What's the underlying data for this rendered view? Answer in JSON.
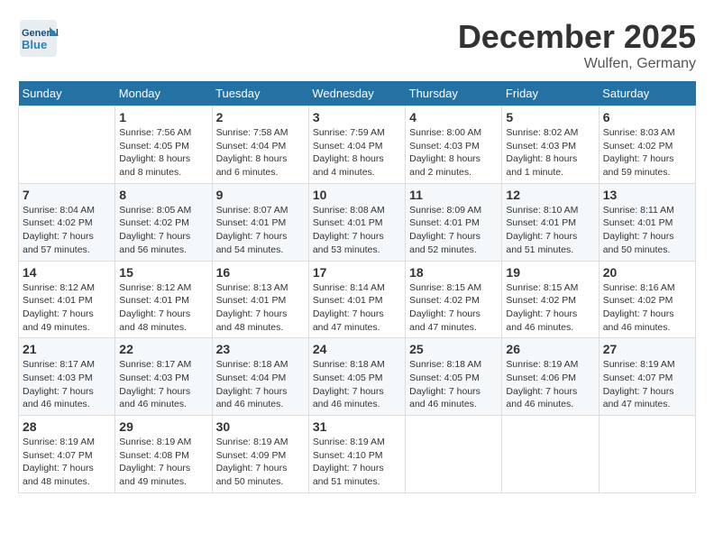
{
  "header": {
    "logo_text_general": "General",
    "logo_text_blue": "Blue",
    "month_title": "December 2025",
    "subtitle": "Wulfen, Germany"
  },
  "weekdays": [
    "Sunday",
    "Monday",
    "Tuesday",
    "Wednesday",
    "Thursday",
    "Friday",
    "Saturday"
  ],
  "weeks": [
    [
      {
        "day": "",
        "sunrise": "",
        "sunset": "",
        "daylight": ""
      },
      {
        "day": "1",
        "sunrise": "Sunrise: 7:56 AM",
        "sunset": "Sunset: 4:05 PM",
        "daylight": "Daylight: 8 hours and 8 minutes."
      },
      {
        "day": "2",
        "sunrise": "Sunrise: 7:58 AM",
        "sunset": "Sunset: 4:04 PM",
        "daylight": "Daylight: 8 hours and 6 minutes."
      },
      {
        "day": "3",
        "sunrise": "Sunrise: 7:59 AM",
        "sunset": "Sunset: 4:04 PM",
        "daylight": "Daylight: 8 hours and 4 minutes."
      },
      {
        "day": "4",
        "sunrise": "Sunrise: 8:00 AM",
        "sunset": "Sunset: 4:03 PM",
        "daylight": "Daylight: 8 hours and 2 minutes."
      },
      {
        "day": "5",
        "sunrise": "Sunrise: 8:02 AM",
        "sunset": "Sunset: 4:03 PM",
        "daylight": "Daylight: 8 hours and 1 minute."
      },
      {
        "day": "6",
        "sunrise": "Sunrise: 8:03 AM",
        "sunset": "Sunset: 4:02 PM",
        "daylight": "Daylight: 7 hours and 59 minutes."
      }
    ],
    [
      {
        "day": "7",
        "sunrise": "Sunrise: 8:04 AM",
        "sunset": "Sunset: 4:02 PM",
        "daylight": "Daylight: 7 hours and 57 minutes."
      },
      {
        "day": "8",
        "sunrise": "Sunrise: 8:05 AM",
        "sunset": "Sunset: 4:02 PM",
        "daylight": "Daylight: 7 hours and 56 minutes."
      },
      {
        "day": "9",
        "sunrise": "Sunrise: 8:07 AM",
        "sunset": "Sunset: 4:01 PM",
        "daylight": "Daylight: 7 hours and 54 minutes."
      },
      {
        "day": "10",
        "sunrise": "Sunrise: 8:08 AM",
        "sunset": "Sunset: 4:01 PM",
        "daylight": "Daylight: 7 hours and 53 minutes."
      },
      {
        "day": "11",
        "sunrise": "Sunrise: 8:09 AM",
        "sunset": "Sunset: 4:01 PM",
        "daylight": "Daylight: 7 hours and 52 minutes."
      },
      {
        "day": "12",
        "sunrise": "Sunrise: 8:10 AM",
        "sunset": "Sunset: 4:01 PM",
        "daylight": "Daylight: 7 hours and 51 minutes."
      },
      {
        "day": "13",
        "sunrise": "Sunrise: 8:11 AM",
        "sunset": "Sunset: 4:01 PM",
        "daylight": "Daylight: 7 hours and 50 minutes."
      }
    ],
    [
      {
        "day": "14",
        "sunrise": "Sunrise: 8:12 AM",
        "sunset": "Sunset: 4:01 PM",
        "daylight": "Daylight: 7 hours and 49 minutes."
      },
      {
        "day": "15",
        "sunrise": "Sunrise: 8:12 AM",
        "sunset": "Sunset: 4:01 PM",
        "daylight": "Daylight: 7 hours and 48 minutes."
      },
      {
        "day": "16",
        "sunrise": "Sunrise: 8:13 AM",
        "sunset": "Sunset: 4:01 PM",
        "daylight": "Daylight: 7 hours and 48 minutes."
      },
      {
        "day": "17",
        "sunrise": "Sunrise: 8:14 AM",
        "sunset": "Sunset: 4:01 PM",
        "daylight": "Daylight: 7 hours and 47 minutes."
      },
      {
        "day": "18",
        "sunrise": "Sunrise: 8:15 AM",
        "sunset": "Sunset: 4:02 PM",
        "daylight": "Daylight: 7 hours and 47 minutes."
      },
      {
        "day": "19",
        "sunrise": "Sunrise: 8:15 AM",
        "sunset": "Sunset: 4:02 PM",
        "daylight": "Daylight: 7 hours and 46 minutes."
      },
      {
        "day": "20",
        "sunrise": "Sunrise: 8:16 AM",
        "sunset": "Sunset: 4:02 PM",
        "daylight": "Daylight: 7 hours and 46 minutes."
      }
    ],
    [
      {
        "day": "21",
        "sunrise": "Sunrise: 8:17 AM",
        "sunset": "Sunset: 4:03 PM",
        "daylight": "Daylight: 7 hours and 46 minutes."
      },
      {
        "day": "22",
        "sunrise": "Sunrise: 8:17 AM",
        "sunset": "Sunset: 4:03 PM",
        "daylight": "Daylight: 7 hours and 46 minutes."
      },
      {
        "day": "23",
        "sunrise": "Sunrise: 8:18 AM",
        "sunset": "Sunset: 4:04 PM",
        "daylight": "Daylight: 7 hours and 46 minutes."
      },
      {
        "day": "24",
        "sunrise": "Sunrise: 8:18 AM",
        "sunset": "Sunset: 4:05 PM",
        "daylight": "Daylight: 7 hours and 46 minutes."
      },
      {
        "day": "25",
        "sunrise": "Sunrise: 8:18 AM",
        "sunset": "Sunset: 4:05 PM",
        "daylight": "Daylight: 7 hours and 46 minutes."
      },
      {
        "day": "26",
        "sunrise": "Sunrise: 8:19 AM",
        "sunset": "Sunset: 4:06 PM",
        "daylight": "Daylight: 7 hours and 46 minutes."
      },
      {
        "day": "27",
        "sunrise": "Sunrise: 8:19 AM",
        "sunset": "Sunset: 4:07 PM",
        "daylight": "Daylight: 7 hours and 47 minutes."
      }
    ],
    [
      {
        "day": "28",
        "sunrise": "Sunrise: 8:19 AM",
        "sunset": "Sunset: 4:07 PM",
        "daylight": "Daylight: 7 hours and 48 minutes."
      },
      {
        "day": "29",
        "sunrise": "Sunrise: 8:19 AM",
        "sunset": "Sunset: 4:08 PM",
        "daylight": "Daylight: 7 hours and 49 minutes."
      },
      {
        "day": "30",
        "sunrise": "Sunrise: 8:19 AM",
        "sunset": "Sunset: 4:09 PM",
        "daylight": "Daylight: 7 hours and 50 minutes."
      },
      {
        "day": "31",
        "sunrise": "Sunrise: 8:19 AM",
        "sunset": "Sunset: 4:10 PM",
        "daylight": "Daylight: 7 hours and 51 minutes."
      },
      {
        "day": "",
        "sunrise": "",
        "sunset": "",
        "daylight": ""
      },
      {
        "day": "",
        "sunrise": "",
        "sunset": "",
        "daylight": ""
      },
      {
        "day": "",
        "sunrise": "",
        "sunset": "",
        "daylight": ""
      }
    ]
  ]
}
